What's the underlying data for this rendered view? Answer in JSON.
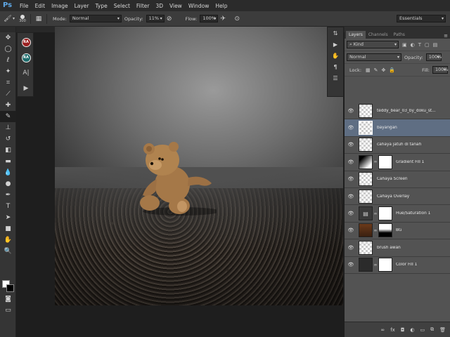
{
  "app": {
    "logo": "Ps"
  },
  "menu": [
    "File",
    "Edit",
    "Image",
    "Layer",
    "Type",
    "Select",
    "Filter",
    "3D",
    "View",
    "Window",
    "Help"
  ],
  "options": {
    "brush_size": "300",
    "mode_label": "Mode:",
    "mode_value": "Normal",
    "opacity_label": "Opacity:",
    "opacity_value": "11%",
    "flow_label": "Flow:",
    "flow_value": "100%",
    "workspace": "Essentials"
  },
  "subpanel": {
    "btn1": "RA",
    "btn2": "RA",
    "char": "A|"
  },
  "layers_panel": {
    "tabs": [
      "Layers",
      "Channels",
      "Paths"
    ],
    "filter_label": "Kind",
    "blend_mode": "Normal",
    "opacity_label": "Opacity:",
    "opacity_value": "100%",
    "lock_label": "Lock:",
    "fill_label": "Fill:",
    "fill_value": "100%",
    "layers": [
      {
        "name": "teddy_bear_03_by_doku_st...",
        "selected": false
      },
      {
        "name": "bayangan",
        "selected": true
      },
      {
        "name": "cahaya jatuh di tanah",
        "selected": false
      },
      {
        "name": "Gradient Fill 1",
        "selected": false
      },
      {
        "name": "Cahaya Screen",
        "selected": false
      },
      {
        "name": "Cahaya Overlay",
        "selected": false
      },
      {
        "name": "Hue/Saturation 1",
        "selected": false
      },
      {
        "name": "BG",
        "selected": false
      },
      {
        "name": "brush awan",
        "selected": false
      },
      {
        "name": "Color Fill 1",
        "selected": false
      }
    ]
  },
  "colors": {
    "selected_layer": "#5f6e83",
    "panel_bg": "#535353",
    "ps_blue": "#5fa8e6"
  }
}
